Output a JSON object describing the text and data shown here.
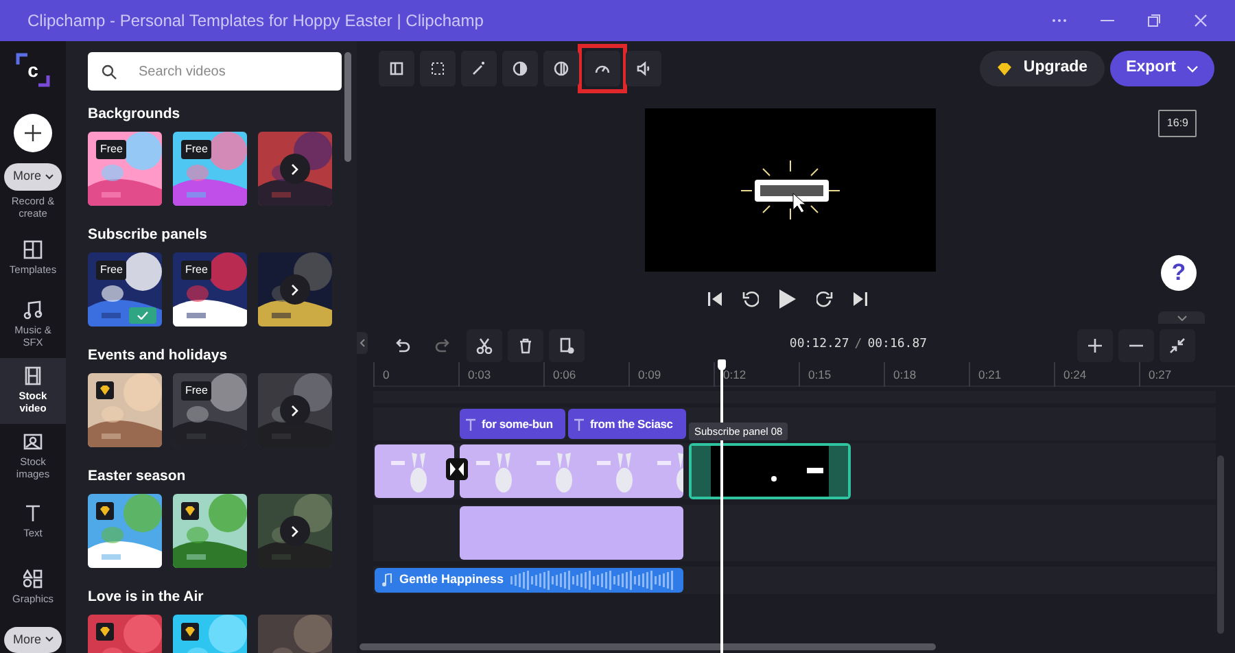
{
  "window": {
    "title": "Clipchamp - Personal Templates for Hoppy Easter | Clipchamp"
  },
  "nav": {
    "logo": "c",
    "more_top": "More",
    "more_bottom": "More",
    "items": [
      {
        "label": "Record & create",
        "selected": false
      },
      {
        "label": "Templates",
        "selected": false
      },
      {
        "label": "Music & SFX",
        "selected": false
      },
      {
        "label": "Stock video",
        "selected": true
      },
      {
        "label": "Stock images",
        "selected": false
      },
      {
        "label": "Text",
        "selected": false
      },
      {
        "label": "Graphics",
        "selected": false
      }
    ]
  },
  "search": {
    "placeholder": "Search videos"
  },
  "sections": [
    {
      "title": "Backgrounds",
      "tiles": [
        {
          "kind": "free",
          "badge": "Free",
          "added": false
        },
        {
          "kind": "free",
          "badge": "Free",
          "added": false
        },
        {
          "kind": "more",
          "added": false
        }
      ]
    },
    {
      "title": "Subscribe panels",
      "tiles": [
        {
          "kind": "free",
          "badge": "Free",
          "added": true
        },
        {
          "kind": "free",
          "badge": "Free",
          "added": false
        },
        {
          "kind": "more",
          "added": false
        }
      ]
    },
    {
      "title": "Events and holidays",
      "tiles": [
        {
          "kind": "premium",
          "added": false
        },
        {
          "kind": "free",
          "badge": "Free",
          "added": false
        },
        {
          "kind": "more",
          "added": false
        }
      ]
    },
    {
      "title": "Easter season",
      "tiles": [
        {
          "kind": "premium",
          "added": false
        },
        {
          "kind": "premium",
          "added": false
        },
        {
          "kind": "more",
          "added": false
        }
      ]
    },
    {
      "title": "Love is in the Air",
      "tiles": [
        {
          "kind": "premium",
          "added": false
        },
        {
          "kind": "premium",
          "added": false
        },
        {
          "kind": "plain",
          "added": false
        }
      ]
    }
  ],
  "toolbar": {
    "tools": [
      {
        "highlighted": false
      },
      {
        "highlighted": false
      },
      {
        "highlighted": false
      },
      {
        "highlighted": false
      },
      {
        "highlighted": false
      },
      {
        "highlighted": true
      },
      {
        "highlighted": false
      }
    ],
    "upgrade": "Upgrade",
    "export": "Export"
  },
  "preview": {
    "aspect": "16:9",
    "help": "?"
  },
  "timeline": {
    "timecode": {
      "current": "00:12.27",
      "separator": "/",
      "total": "00:16.87"
    },
    "ruler": [
      "0",
      "0:03",
      "0:06",
      "0:09",
      "0:12",
      "0:15",
      "0:18",
      "0:21",
      "0:24",
      "0:27"
    ],
    "tooltip": "Subscribe panel 08",
    "text_clips": [
      {
        "label": "for some-bun"
      },
      {
        "label": "from the Sciasc"
      }
    ],
    "video_clips": [
      {
        "selected": false
      },
      {
        "selected": false
      },
      {
        "selected": true
      }
    ],
    "overlay_clips": [
      {
        "selected": false
      }
    ],
    "audio_clips": [
      {
        "label": "Gentle Happiness"
      }
    ]
  }
}
